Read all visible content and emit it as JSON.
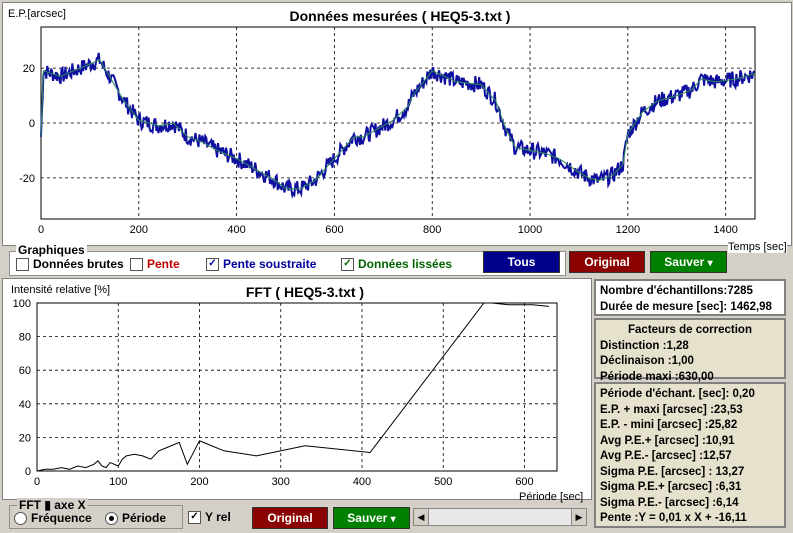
{
  "colors": {
    "raw_line": "#1010a0",
    "smoothed_line": "#2e8b57",
    "fft_line": "#000000",
    "btn_blue": "#00008b",
    "btn_red": "#8b0000",
    "btn_green": "#008000",
    "info_bg": "#e6e1cc"
  },
  "top": {
    "ylabel": "E.P.[arcsec]",
    "title": "Données mesurées ( HEQ5-3.txt )",
    "xlabel": "Temps [sec]",
    "yticks": [
      "20",
      "0",
      "-20"
    ],
    "xticks": [
      "0",
      "200",
      "400",
      "600",
      "800",
      "1000",
      "1200",
      "1400"
    ]
  },
  "graphiques": {
    "label": "Graphiques",
    "raw": {
      "label": "Données brutes",
      "checked": false
    },
    "pente": {
      "label": "Pente",
      "checked": false
    },
    "pente_sous": {
      "label": "Pente soustraite",
      "checked": true
    },
    "lissees": {
      "label": "Données lissées",
      "checked": true
    }
  },
  "buttons": {
    "tous": "Tous",
    "original": "Original",
    "sauver": "Sauver",
    "dropdown": "▾"
  },
  "fft": {
    "ylabel": "Intensité relative [%]",
    "title": "FFT ( HEQ5-3.txt )",
    "xlabel": "Période [sec]",
    "yticks": [
      "100",
      "80",
      "60",
      "40",
      "20",
      "0"
    ],
    "xticks": [
      "0",
      "100",
      "200",
      "300",
      "400",
      "500",
      "600"
    ]
  },
  "fft_axis": {
    "label": "FFT ▮ axe X",
    "freq": "Fréquence",
    "periode": "Période",
    "selected": "Période",
    "yrel_label": "Y rel",
    "yrel_checked": true
  },
  "info1": {
    "line1": "Nombre d'échantillons:7285",
    "line2": "Durée de mesure [sec]: 1462,98"
  },
  "info2": {
    "title": "Facteurs de correction",
    "line1": "Distinction :1,28",
    "line2": "Déclinaison :1,00",
    "line3": "Période maxi :630,00"
  },
  "info3": {
    "lines": [
      "Période d'échant. [sec]: 0,20",
      "E.P. + maxi [arcsec] :23,53",
      "E.P. - mini [arcsec] :25,82",
      "Avg P.E.+ [arcsec] :10,91",
      "Avg P.E.- [arcsec] :12,57",
      "Sigma P.E. [arcsec] : 13,27",
      "Sigma P.E.+ [arcsec] :6,31",
      "Sigma P.E.- [arcsec] :6,14",
      "Pente :Y = 0,01 x X + -16,11"
    ]
  },
  "scroll": {
    "left": "◀",
    "right": "▶"
  },
  "chart_data": [
    {
      "type": "line",
      "title": "Données mesurées ( HEQ5-3.txt )",
      "xlabel": "Temps [sec]",
      "ylabel": "E.P.[arcsec]",
      "xlim": [
        0,
        1460
      ],
      "ylim": [
        -35,
        35
      ],
      "grid": true,
      "series": [
        {
          "name": "Données lissées",
          "x": [
            0,
            5,
            40,
            80,
            120,
            140,
            170,
            200,
            240,
            270,
            300,
            330,
            360,
            400,
            450,
            480,
            500,
            530,
            560,
            590,
            620,
            640,
            660,
            690,
            720,
            750,
            760,
            800,
            850,
            900,
            930,
            950,
            970,
            1000,
            1030,
            1060,
            1100,
            1120,
            1140,
            1170,
            1190,
            1200,
            1230,
            1260,
            1300,
            1330,
            1350,
            1380,
            1420,
            1460
          ],
          "y": [
            -5,
            19,
            17,
            20,
            23,
            17,
            8,
            1,
            -1,
            0,
            -5,
            -7,
            -10,
            -13,
            -18,
            -21,
            -24,
            -24,
            -21,
            -15,
            -9,
            -5,
            -5,
            -2,
            1,
            6,
            10,
            19,
            15,
            14,
            8,
            -2,
            -9,
            -10,
            -11,
            -13,
            -18,
            -20,
            -21,
            -19,
            -15,
            -4,
            4,
            8,
            10,
            12,
            16,
            15,
            16,
            18
          ]
        }
      ]
    },
    {
      "type": "line",
      "title": "FFT ( HEQ5-3.txt )",
      "xlabel": "Période [sec]",
      "ylabel": "Intensité relative [%]",
      "xlim": [
        0,
        640
      ],
      "ylim": [
        0,
        100
      ],
      "grid": true,
      "series": [
        {
          "name": "FFT",
          "x": [
            0,
            10,
            20,
            30,
            40,
            50,
            60,
            70,
            75,
            80,
            85,
            90,
            100,
            105,
            110,
            120,
            130,
            140,
            150,
            160,
            175,
            185,
            200,
            210,
            230,
            270,
            330,
            410,
            550,
            560,
            580,
            610,
            630
          ],
          "y": [
            0,
            1,
            1,
            2,
            1,
            3,
            2,
            4,
            6,
            3,
            2,
            5,
            3,
            7,
            9,
            10,
            9,
            7,
            12,
            14,
            17,
            4,
            18,
            16,
            12,
            9,
            15,
            11,
            100,
            100,
            99,
            99,
            98
          ]
        }
      ]
    }
  ]
}
